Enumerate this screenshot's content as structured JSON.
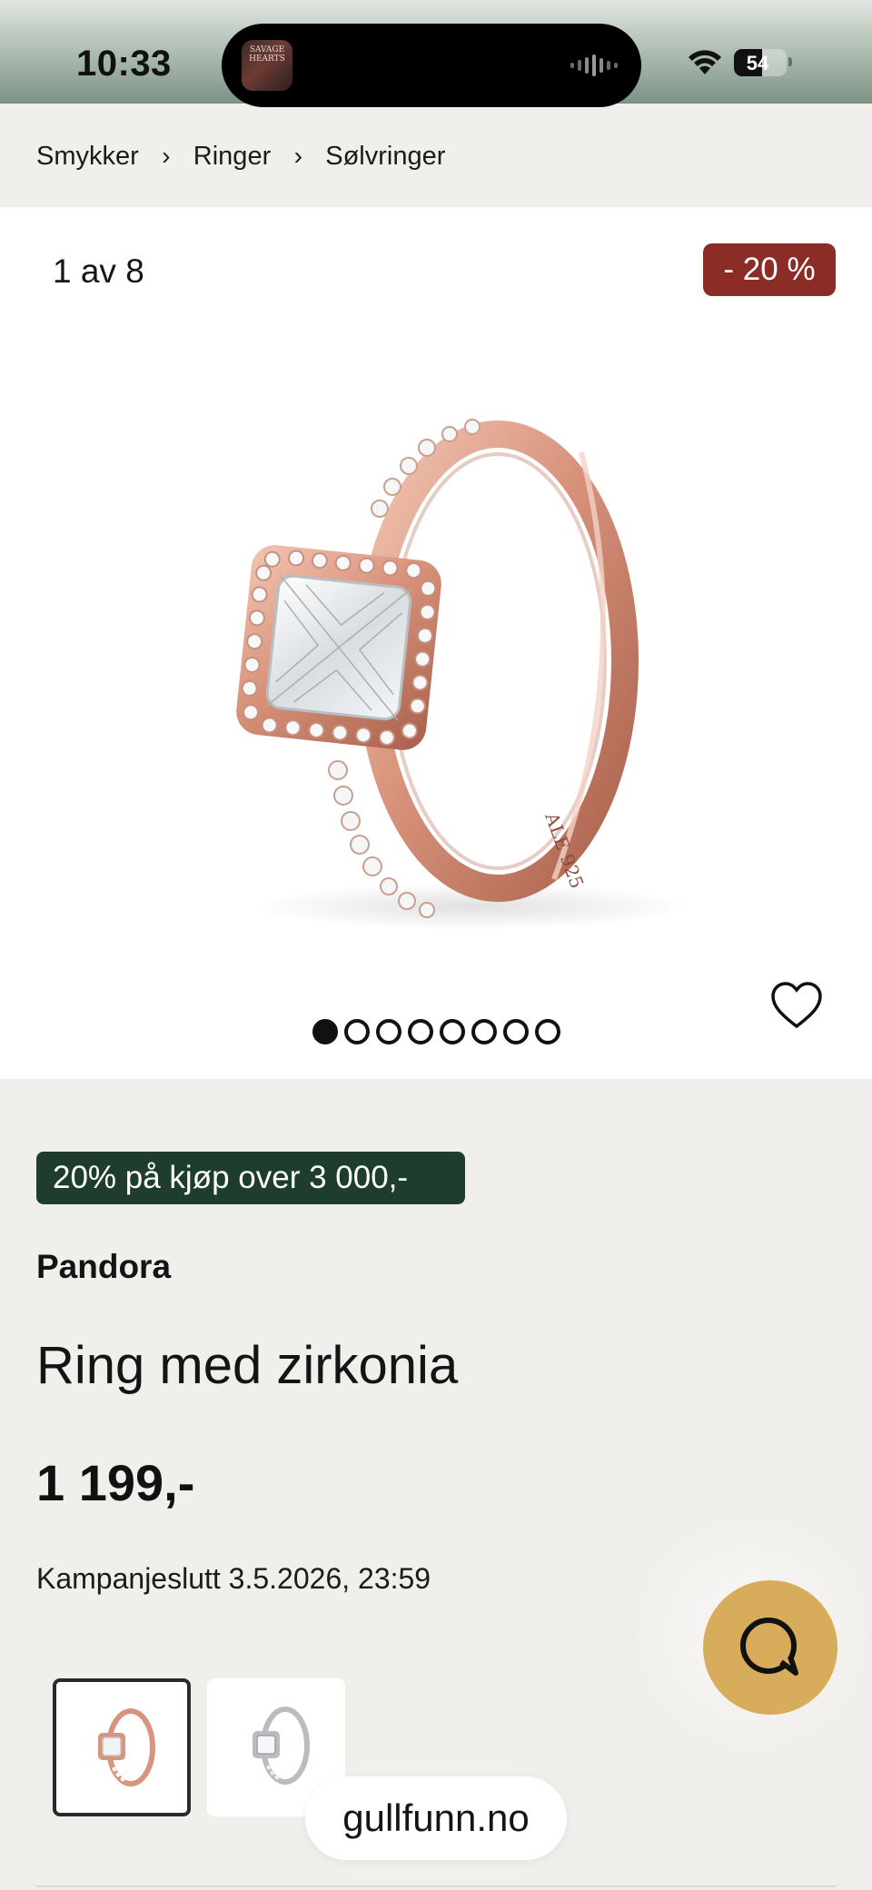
{
  "status_bar": {
    "time": "10:33",
    "battery_percent": "54",
    "battery_level": 0.54,
    "album_art_text": "SAVAGE HEARTS",
    "icons": [
      "waveform-icon",
      "wifi-icon",
      "battery-icon"
    ]
  },
  "breadcrumb": {
    "items": [
      "Smykker",
      "Ringer",
      "Sølvringer"
    ],
    "separator": "›"
  },
  "gallery": {
    "counter": "1 av 8",
    "discount_badge": "- 20 %",
    "image_count": 8,
    "active_index": 0
  },
  "product": {
    "promo": "20% på kjøp over 3 000,-",
    "brand": "Pandora",
    "title": "Ring med zirkonia",
    "price": "1 199,-",
    "campaign_end": "Kampanjeslutt 3.5.2026, 23:59"
  },
  "variants": {
    "items": [
      {
        "name": "rose-gold",
        "selected": true
      },
      {
        "name": "silver",
        "selected": false
      }
    ]
  },
  "browser": {
    "url": "gullfunn.no"
  },
  "colors": {
    "accent_red": "#8b2c26",
    "promo_green": "#1f3d2e",
    "chat_gold": "#d7ac5a",
    "rose_gold": "#d89a84",
    "background": "#f1efec"
  }
}
